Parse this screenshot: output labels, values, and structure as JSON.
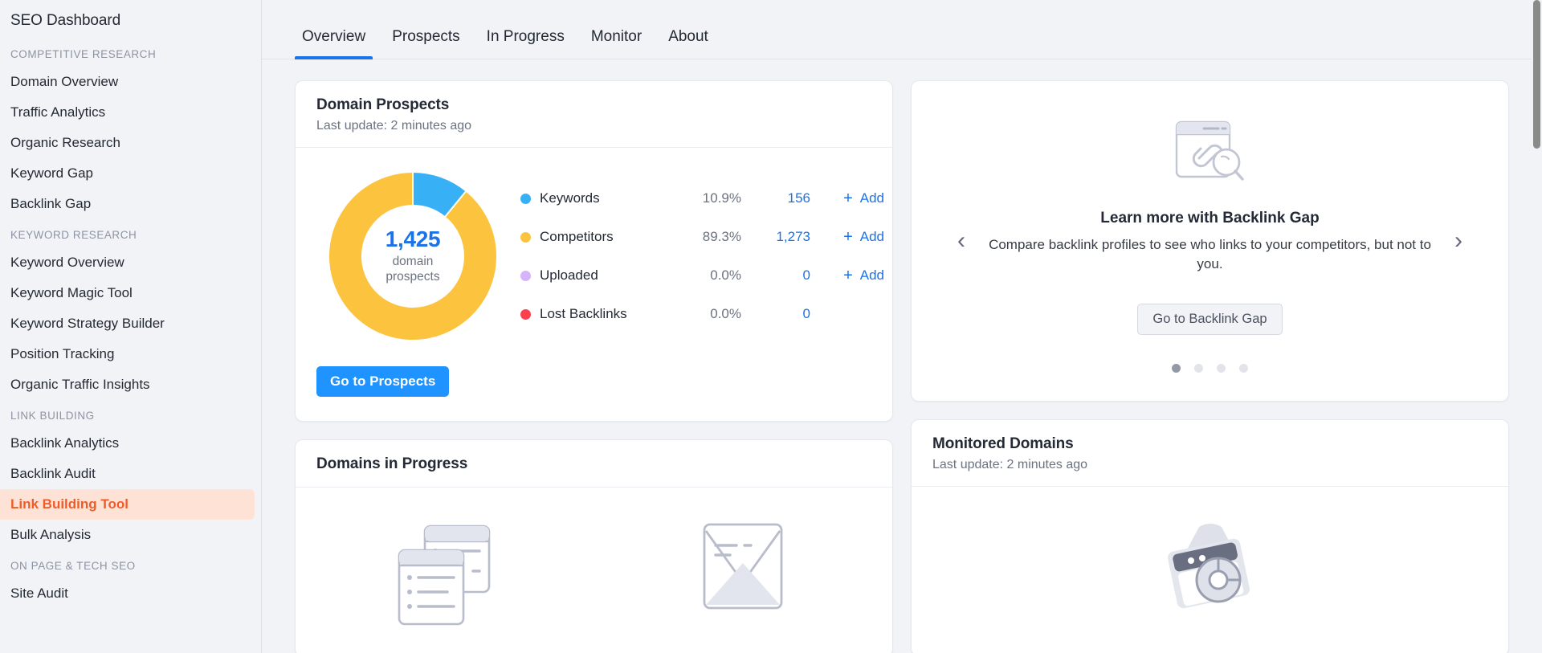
{
  "sidebar": {
    "title": "SEO Dashboard",
    "groups": [
      {
        "label": "COMPETITIVE RESEARCH",
        "items": [
          {
            "label": "Domain Overview",
            "active": false
          },
          {
            "label": "Traffic Analytics",
            "active": false
          },
          {
            "label": "Organic Research",
            "active": false
          },
          {
            "label": "Keyword Gap",
            "active": false
          },
          {
            "label": "Backlink Gap",
            "active": false
          }
        ]
      },
      {
        "label": "KEYWORD RESEARCH",
        "items": [
          {
            "label": "Keyword Overview",
            "active": false
          },
          {
            "label": "Keyword Magic Tool",
            "active": false
          },
          {
            "label": "Keyword Strategy Builder",
            "active": false
          },
          {
            "label": "Position Tracking",
            "active": false
          },
          {
            "label": "Organic Traffic Insights",
            "active": false
          }
        ]
      },
      {
        "label": "LINK BUILDING",
        "items": [
          {
            "label": "Backlink Analytics",
            "active": false
          },
          {
            "label": "Backlink Audit",
            "active": false
          },
          {
            "label": "Link Building Tool",
            "active": true
          },
          {
            "label": "Bulk Analysis",
            "active": false
          }
        ]
      },
      {
        "label": "ON PAGE & TECH SEO",
        "items": [
          {
            "label": "Site Audit",
            "active": false
          }
        ]
      }
    ]
  },
  "tabs": [
    {
      "label": "Overview",
      "active": true
    },
    {
      "label": "Prospects",
      "active": false
    },
    {
      "label": "In Progress",
      "active": false
    },
    {
      "label": "Monitor",
      "active": false
    },
    {
      "label": "About",
      "active": false
    }
  ],
  "prospects_card": {
    "title": "Domain Prospects",
    "subtitle": "Last update: 2 minutes ago",
    "cta": "Go to Prospects",
    "center_value": "1,425",
    "center_label_line1": "domain",
    "center_label_line2": "prospects",
    "add_label": "Add",
    "add_plus": "+"
  },
  "chart_data": {
    "type": "pie",
    "title": "Domain Prospects",
    "total": 1425,
    "total_label": "domain prospects",
    "legend_position": "right",
    "categories": [
      "Keywords",
      "Competitors",
      "Uploaded",
      "Lost Backlinks"
    ],
    "values": [
      156,
      1273,
      0,
      0
    ],
    "percentages": [
      "10.9%",
      "89.3%",
      "0.0%",
      "0.0%"
    ],
    "value_labels": [
      "156",
      "1,273",
      "0",
      "0"
    ],
    "colors": [
      "#37b0f5",
      "#fcc33e",
      "#d6b4fb",
      "#fc3f4d"
    ],
    "has_add_action": [
      true,
      true,
      true,
      false
    ]
  },
  "promo_card": {
    "title": "Learn more with Backlink Gap",
    "description": "Compare backlink profiles to see who links to your competitors, but not to you.",
    "cta": "Go to Backlink Gap",
    "prev_arrow": "‹",
    "next_arrow": "›",
    "dots": [
      true,
      false,
      false,
      false
    ]
  },
  "progress_card": {
    "title": "Domains in Progress"
  },
  "monitored_card": {
    "title": "Monitored Domains",
    "subtitle": "Last update: 2 minutes ago"
  },
  "colors": {
    "accent_blue": "#1a73e8",
    "button_blue": "#1f93ff",
    "active_orange": "#ef5c28",
    "active_orange_bg": "#ffe2d6",
    "page_bg": "#f2f3f7"
  }
}
